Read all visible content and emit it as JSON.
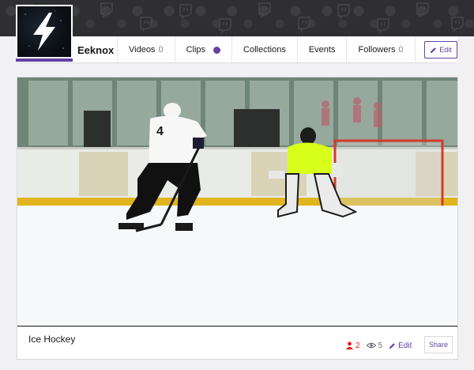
{
  "channel": {
    "name": "Eeknox",
    "edit_label": "Edit"
  },
  "nav": {
    "tabs": [
      {
        "label": "Videos",
        "count": "0"
      },
      {
        "label": "Clips",
        "count": ""
      },
      {
        "label": "Collections",
        "count": ""
      },
      {
        "label": "Events",
        "count": ""
      },
      {
        "label": "Followers",
        "count": "0"
      }
    ],
    "more_label": "•••"
  },
  "video": {
    "title": "Ice Hockey",
    "player_number": "4",
    "likes": "2",
    "views": "5",
    "edit_label": "Edit",
    "share_label": "Share"
  },
  "colors": {
    "accent": "#6441a4",
    "heart": "#e91916",
    "banner": "#2f2f33"
  },
  "icons": {
    "logo": "lightning-bolt-icon",
    "edit": "pencil-icon",
    "likes": "person-icon",
    "views": "eye-icon",
    "more": "ellipsis-icon"
  }
}
